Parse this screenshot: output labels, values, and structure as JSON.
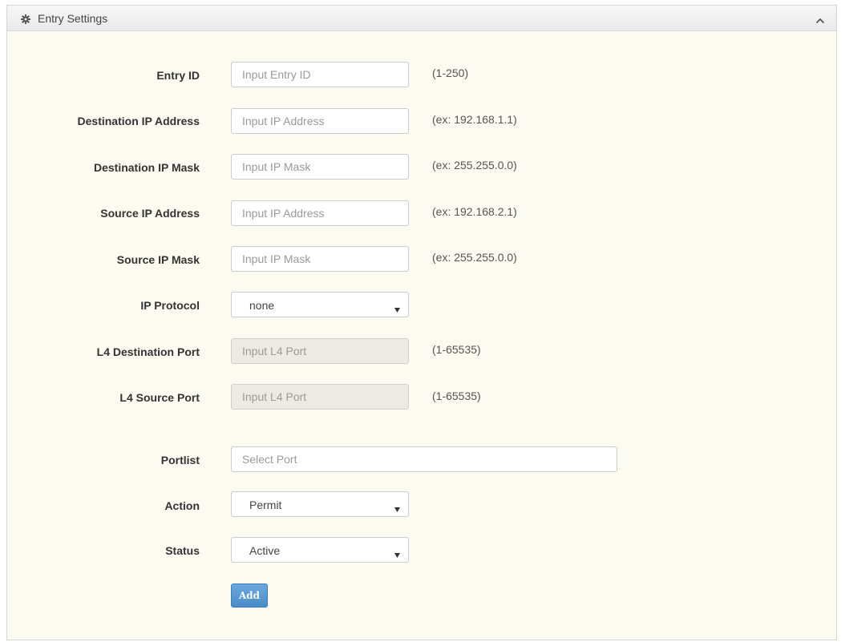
{
  "panel": {
    "title": "Entry Settings",
    "header_icon": "gear-icon",
    "collapse_icon": "chevron-up-icon"
  },
  "form": {
    "entry_id": {
      "label": "Entry ID",
      "placeholder": "Input Entry ID",
      "hint": "(1-250)"
    },
    "dest_ip": {
      "label": "Destination IP Address",
      "placeholder": "Input IP Address",
      "hint": "(ex: 192.168.1.1)"
    },
    "dest_mask": {
      "label": "Destination IP Mask",
      "placeholder": "Input IP Mask",
      "hint": "(ex: 255.255.0.0)"
    },
    "src_ip": {
      "label": "Source IP Address",
      "placeholder": "Input IP Address",
      "hint": "(ex: 192.168.2.1)"
    },
    "src_mask": {
      "label": "Source IP Mask",
      "placeholder": "Input IP Mask",
      "hint": "(ex: 255.255.0.0)"
    },
    "ip_protocol": {
      "label": "IP Protocol",
      "value": "none"
    },
    "l4_dest_port": {
      "label": "L4 Destination Port",
      "placeholder": "Input L4 Port",
      "hint": "(1-65535)",
      "disabled": true
    },
    "l4_src_port": {
      "label": "L4 Source Port",
      "placeholder": "Input L4 Port",
      "hint": "(1-65535)",
      "disabled": true
    },
    "portlist": {
      "label": "Portlist",
      "placeholder": "Select Port"
    },
    "action": {
      "label": "Action",
      "value": "Permit"
    },
    "status": {
      "label": "Status",
      "value": "Active"
    }
  },
  "buttons": {
    "add_label": "Add"
  },
  "colors": {
    "panel_bg": "#fbfbf2",
    "button_blue": "#5b9bd5",
    "disabled_field": "#ebebe4"
  }
}
